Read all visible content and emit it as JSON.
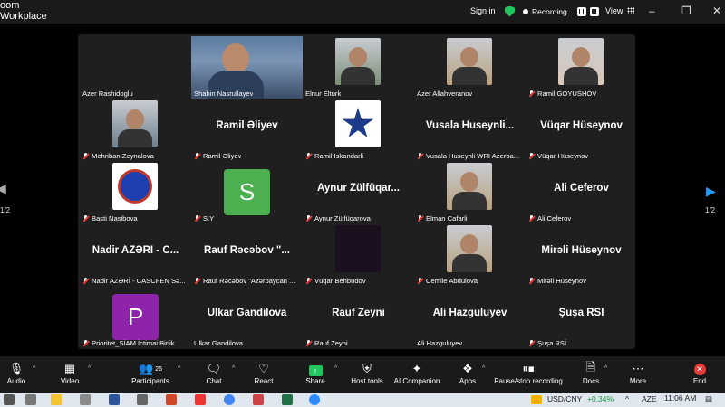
{
  "window": {
    "title_line1": "oom",
    "title_line2": "Workplace",
    "signin": "Sign in",
    "recording": "Recording...",
    "view": "View"
  },
  "gallery": {
    "page_left": "1/2",
    "page_right": "1/2",
    "tiles": [
      {
        "label": "Azer Rashidoglu",
        "muted": false,
        "kind": "blank"
      },
      {
        "label": "Shahin Nasrullayev",
        "muted": false,
        "kind": "video",
        "active": true
      },
      {
        "label": "Elnur Elturk",
        "muted": false,
        "kind": "photo"
      },
      {
        "label": "Azer Allahveranov",
        "muted": false,
        "kind": "photo"
      },
      {
        "label": "Ramil GOYUSHOV",
        "muted": true,
        "kind": "photo"
      },
      {
        "label": "Mehriban Zeynalova",
        "muted": true,
        "kind": "photo"
      },
      {
        "label": "Ramil Əliyev",
        "muted": true,
        "kind": "name",
        "big": "Ramil Əliyev"
      },
      {
        "label": "Ramil Iskandarli",
        "muted": true,
        "kind": "logo-star"
      },
      {
        "label": "Vusala Huseynli WRI Azerba...",
        "muted": true,
        "kind": "name",
        "big": "Vusala Huseynli..."
      },
      {
        "label": "Vüqar Hüseynov",
        "muted": true,
        "kind": "name",
        "big": "Vüqar Hüseynov"
      },
      {
        "label": "Basti Nasibova",
        "muted": true,
        "kind": "logo-circle"
      },
      {
        "label": "S.Y",
        "muted": true,
        "kind": "letter",
        "letter": "S",
        "color": "#4caf50"
      },
      {
        "label": "Aynur Zülfüqarova",
        "muted": true,
        "kind": "name",
        "big": "Aynur Zülfüqar..."
      },
      {
        "label": "Elman Cafarli",
        "muted": true,
        "kind": "photo"
      },
      {
        "label": "Ali Ceferov",
        "muted": true,
        "kind": "name",
        "big": "Ali Ceferov"
      },
      {
        "label": "Nadir AZƏRİ - CASCFEN Sə...",
        "muted": true,
        "kind": "name",
        "big": "Nadir AZƏRİ - C..."
      },
      {
        "label": "Rauf Rəcəbov \"Azərbaycan ...",
        "muted": true,
        "kind": "name",
        "big": "Rauf Rəcəbov \"..."
      },
      {
        "label": "Vüqar Behbudov",
        "muted": true,
        "kind": "dark"
      },
      {
        "label": "Cemile Abdulova",
        "muted": true,
        "kind": "photo"
      },
      {
        "label": "Mirəli Hüseynov",
        "muted": true,
        "kind": "name",
        "big": "Mirəli Hüseynov"
      },
      {
        "label": "Prioritet_SİAM İctimai Birlik",
        "muted": true,
        "kind": "letter",
        "letter": "P",
        "color": "#8e24aa"
      },
      {
        "label": "Ulkar Gandilova",
        "muted": false,
        "kind": "name",
        "big": "Ulkar Gandilova"
      },
      {
        "label": "Rauf Zeyni",
        "muted": true,
        "kind": "name",
        "big": "Rauf Zeyni"
      },
      {
        "label": "Ali Hazguluyev",
        "muted": false,
        "kind": "name",
        "big": "Ali Hazguluyev"
      },
      {
        "label": "Şuşa RSİ",
        "muted": true,
        "kind": "name",
        "big": "Şuşa RSİ"
      }
    ]
  },
  "toolbar": {
    "audio": "Audio",
    "video": "Video",
    "participants": "Participants",
    "participants_count": "26",
    "chat": "Chat",
    "react": "React",
    "share": "Share",
    "host_tools": "Host tools",
    "ai_companion": "AI Companion",
    "apps": "Apps",
    "recording": "Pause/stop recording",
    "docs": "Docs",
    "more": "More",
    "end": "End"
  },
  "taskbar": {
    "ticker": "USD/CNY",
    "change": "+0.34%",
    "lang": "AZE",
    "time": "11:06 AM"
  },
  "colors": {
    "active_speaker": "#23d160",
    "muted": "#e53935",
    "end": "#e53935",
    "shield": "#22c55e"
  }
}
